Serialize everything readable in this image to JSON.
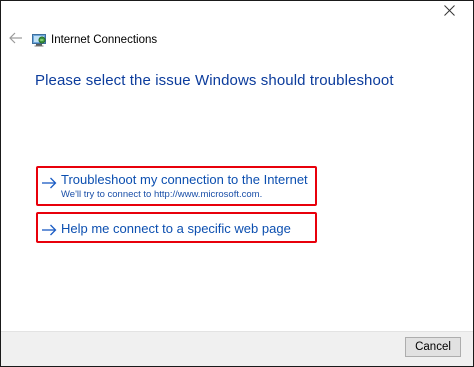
{
  "window": {
    "title": "Internet Connections"
  },
  "icons": {
    "close": "close-icon",
    "back": "back-arrow-icon",
    "app": "internet-connections-icon",
    "option_arrow": "arrow-right-icon"
  },
  "main": {
    "heading": "Please select the issue Windows should troubleshoot",
    "options": [
      {
        "title": "Troubleshoot my connection to the Internet",
        "description": "We'll try to connect to http://www.microsoft.com."
      },
      {
        "title": "Help me connect to a specific web page"
      }
    ]
  },
  "footer": {
    "cancel_label": "Cancel"
  },
  "colors": {
    "heading": "#0c3c9c",
    "link": "#0c4fb0",
    "highlight_border": "#e8000b",
    "footer_bg": "#f0f0f0"
  }
}
